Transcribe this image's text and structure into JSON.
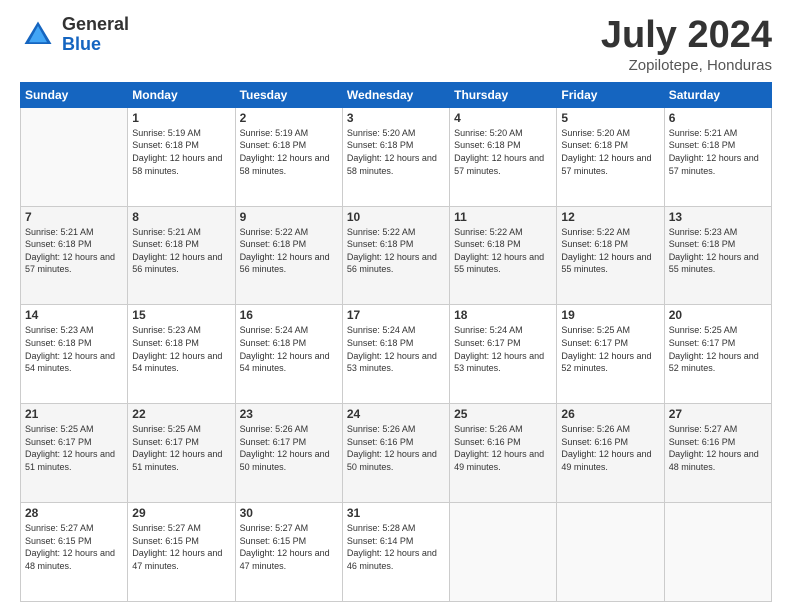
{
  "logo": {
    "general": "General",
    "blue": "Blue"
  },
  "title": "July 2024",
  "subtitle": "Zopilotepe, Honduras",
  "headers": [
    "Sunday",
    "Monday",
    "Tuesday",
    "Wednesday",
    "Thursday",
    "Friday",
    "Saturday"
  ],
  "weeks": [
    [
      {
        "day": "",
        "sunrise": "",
        "sunset": "",
        "daylight": ""
      },
      {
        "day": "1",
        "sunrise": "Sunrise: 5:19 AM",
        "sunset": "Sunset: 6:18 PM",
        "daylight": "Daylight: 12 hours and 58 minutes."
      },
      {
        "day": "2",
        "sunrise": "Sunrise: 5:19 AM",
        "sunset": "Sunset: 6:18 PM",
        "daylight": "Daylight: 12 hours and 58 minutes."
      },
      {
        "day": "3",
        "sunrise": "Sunrise: 5:20 AM",
        "sunset": "Sunset: 6:18 PM",
        "daylight": "Daylight: 12 hours and 58 minutes."
      },
      {
        "day": "4",
        "sunrise": "Sunrise: 5:20 AM",
        "sunset": "Sunset: 6:18 PM",
        "daylight": "Daylight: 12 hours and 57 minutes."
      },
      {
        "day": "5",
        "sunrise": "Sunrise: 5:20 AM",
        "sunset": "Sunset: 6:18 PM",
        "daylight": "Daylight: 12 hours and 57 minutes."
      },
      {
        "day": "6",
        "sunrise": "Sunrise: 5:21 AM",
        "sunset": "Sunset: 6:18 PM",
        "daylight": "Daylight: 12 hours and 57 minutes."
      }
    ],
    [
      {
        "day": "7",
        "sunrise": "Sunrise: 5:21 AM",
        "sunset": "Sunset: 6:18 PM",
        "daylight": "Daylight: 12 hours and 57 minutes."
      },
      {
        "day": "8",
        "sunrise": "Sunrise: 5:21 AM",
        "sunset": "Sunset: 6:18 PM",
        "daylight": "Daylight: 12 hours and 56 minutes."
      },
      {
        "day": "9",
        "sunrise": "Sunrise: 5:22 AM",
        "sunset": "Sunset: 6:18 PM",
        "daylight": "Daylight: 12 hours and 56 minutes."
      },
      {
        "day": "10",
        "sunrise": "Sunrise: 5:22 AM",
        "sunset": "Sunset: 6:18 PM",
        "daylight": "Daylight: 12 hours and 56 minutes."
      },
      {
        "day": "11",
        "sunrise": "Sunrise: 5:22 AM",
        "sunset": "Sunset: 6:18 PM",
        "daylight": "Daylight: 12 hours and 55 minutes."
      },
      {
        "day": "12",
        "sunrise": "Sunrise: 5:22 AM",
        "sunset": "Sunset: 6:18 PM",
        "daylight": "Daylight: 12 hours and 55 minutes."
      },
      {
        "day": "13",
        "sunrise": "Sunrise: 5:23 AM",
        "sunset": "Sunset: 6:18 PM",
        "daylight": "Daylight: 12 hours and 55 minutes."
      }
    ],
    [
      {
        "day": "14",
        "sunrise": "Sunrise: 5:23 AM",
        "sunset": "Sunset: 6:18 PM",
        "daylight": "Daylight: 12 hours and 54 minutes."
      },
      {
        "day": "15",
        "sunrise": "Sunrise: 5:23 AM",
        "sunset": "Sunset: 6:18 PM",
        "daylight": "Daylight: 12 hours and 54 minutes."
      },
      {
        "day": "16",
        "sunrise": "Sunrise: 5:24 AM",
        "sunset": "Sunset: 6:18 PM",
        "daylight": "Daylight: 12 hours and 54 minutes."
      },
      {
        "day": "17",
        "sunrise": "Sunrise: 5:24 AM",
        "sunset": "Sunset: 6:18 PM",
        "daylight": "Daylight: 12 hours and 53 minutes."
      },
      {
        "day": "18",
        "sunrise": "Sunrise: 5:24 AM",
        "sunset": "Sunset: 6:17 PM",
        "daylight": "Daylight: 12 hours and 53 minutes."
      },
      {
        "day": "19",
        "sunrise": "Sunrise: 5:25 AM",
        "sunset": "Sunset: 6:17 PM",
        "daylight": "Daylight: 12 hours and 52 minutes."
      },
      {
        "day": "20",
        "sunrise": "Sunrise: 5:25 AM",
        "sunset": "Sunset: 6:17 PM",
        "daylight": "Daylight: 12 hours and 52 minutes."
      }
    ],
    [
      {
        "day": "21",
        "sunrise": "Sunrise: 5:25 AM",
        "sunset": "Sunset: 6:17 PM",
        "daylight": "Daylight: 12 hours and 51 minutes."
      },
      {
        "day": "22",
        "sunrise": "Sunrise: 5:25 AM",
        "sunset": "Sunset: 6:17 PM",
        "daylight": "Daylight: 12 hours and 51 minutes."
      },
      {
        "day": "23",
        "sunrise": "Sunrise: 5:26 AM",
        "sunset": "Sunset: 6:17 PM",
        "daylight": "Daylight: 12 hours and 50 minutes."
      },
      {
        "day": "24",
        "sunrise": "Sunrise: 5:26 AM",
        "sunset": "Sunset: 6:16 PM",
        "daylight": "Daylight: 12 hours and 50 minutes."
      },
      {
        "day": "25",
        "sunrise": "Sunrise: 5:26 AM",
        "sunset": "Sunset: 6:16 PM",
        "daylight": "Daylight: 12 hours and 49 minutes."
      },
      {
        "day": "26",
        "sunrise": "Sunrise: 5:26 AM",
        "sunset": "Sunset: 6:16 PM",
        "daylight": "Daylight: 12 hours and 49 minutes."
      },
      {
        "day": "27",
        "sunrise": "Sunrise: 5:27 AM",
        "sunset": "Sunset: 6:16 PM",
        "daylight": "Daylight: 12 hours and 48 minutes."
      }
    ],
    [
      {
        "day": "28",
        "sunrise": "Sunrise: 5:27 AM",
        "sunset": "Sunset: 6:15 PM",
        "daylight": "Daylight: 12 hours and 48 minutes."
      },
      {
        "day": "29",
        "sunrise": "Sunrise: 5:27 AM",
        "sunset": "Sunset: 6:15 PM",
        "daylight": "Daylight: 12 hours and 47 minutes."
      },
      {
        "day": "30",
        "sunrise": "Sunrise: 5:27 AM",
        "sunset": "Sunset: 6:15 PM",
        "daylight": "Daylight: 12 hours and 47 minutes."
      },
      {
        "day": "31",
        "sunrise": "Sunrise: 5:28 AM",
        "sunset": "Sunset: 6:14 PM",
        "daylight": "Daylight: 12 hours and 46 minutes."
      },
      {
        "day": "",
        "sunrise": "",
        "sunset": "",
        "daylight": ""
      },
      {
        "day": "",
        "sunrise": "",
        "sunset": "",
        "daylight": ""
      },
      {
        "day": "",
        "sunrise": "",
        "sunset": "",
        "daylight": ""
      }
    ]
  ]
}
